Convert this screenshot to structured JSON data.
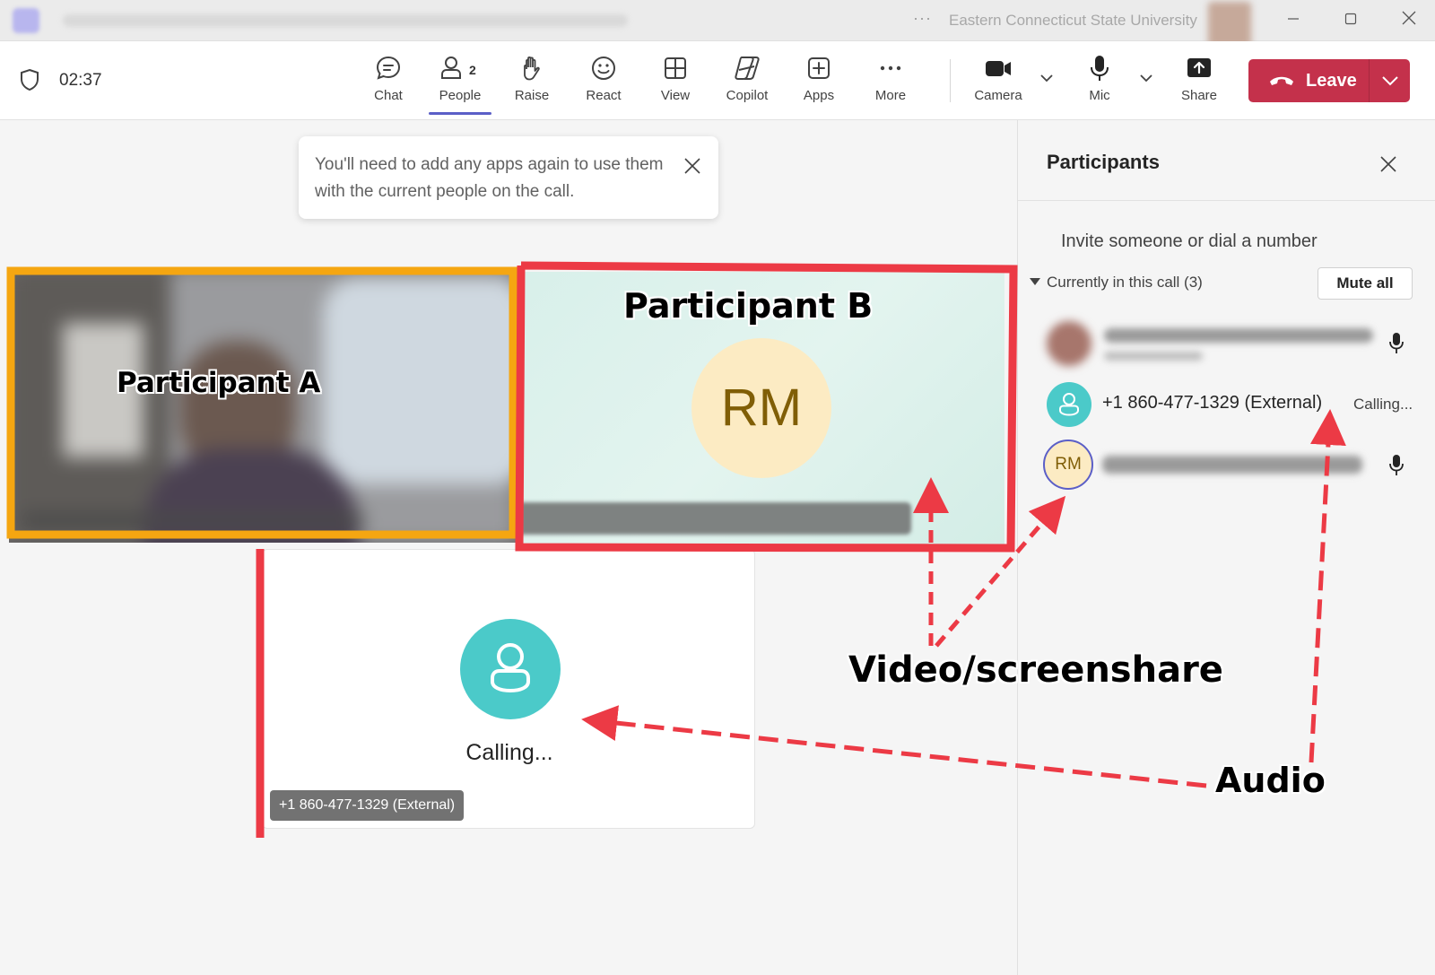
{
  "titlebar": {
    "org_name": "Eastern Connecticut State University",
    "more_icon": "ellipsis-icon",
    "window_controls": [
      "minimize-icon",
      "maximize-icon",
      "close-icon"
    ]
  },
  "toolbar": {
    "timer": "02:37",
    "items": [
      {
        "label": "Chat",
        "icon": "chat-icon"
      },
      {
        "label": "People",
        "icon": "people-icon",
        "badge": "2",
        "active": true
      },
      {
        "label": "Raise",
        "icon": "hand-icon"
      },
      {
        "label": "React",
        "icon": "smile-icon"
      },
      {
        "label": "View",
        "icon": "grid-icon"
      },
      {
        "label": "Copilot",
        "icon": "copilot-icon"
      },
      {
        "label": "Apps",
        "icon": "plus-square-icon"
      },
      {
        "label": "More",
        "icon": "ellipsis-icon"
      },
      {
        "label": "Camera",
        "icon": "camera-icon"
      },
      {
        "label": "Mic",
        "icon": "mic-icon"
      },
      {
        "label": "Share",
        "icon": "share-icon"
      }
    ],
    "leave_label": "Leave",
    "accent": "#5b5fc7",
    "leave_color": "#c4314b"
  },
  "toast": {
    "message": "You'll need to add any apps again to use them with the current people on the call."
  },
  "stage": {
    "participant_b_initials": "RM",
    "caller_status": "Calling...",
    "caller_name": "+1 860-477-1329 (External)"
  },
  "panel": {
    "title": "Participants",
    "invite_placeholder": "Invite someone or dial a number",
    "section_label": "Currently in this call (3)",
    "mute_all_label": "Mute all",
    "participants": [
      {
        "name": "",
        "status": "",
        "mic": true
      },
      {
        "name": "+1 860-477-1329 (External)",
        "status": "Calling...",
        "mic": false
      },
      {
        "initials": "RM",
        "name": "",
        "status": "",
        "mic": true
      }
    ]
  },
  "annotations": {
    "participant_a": "Participant A",
    "participant_b": "Participant B",
    "video_screenshare": "Video/screenshare",
    "audio": "Audio",
    "participant_a_box_color": "#f5a611",
    "highlight_color": "#ec3a45"
  }
}
